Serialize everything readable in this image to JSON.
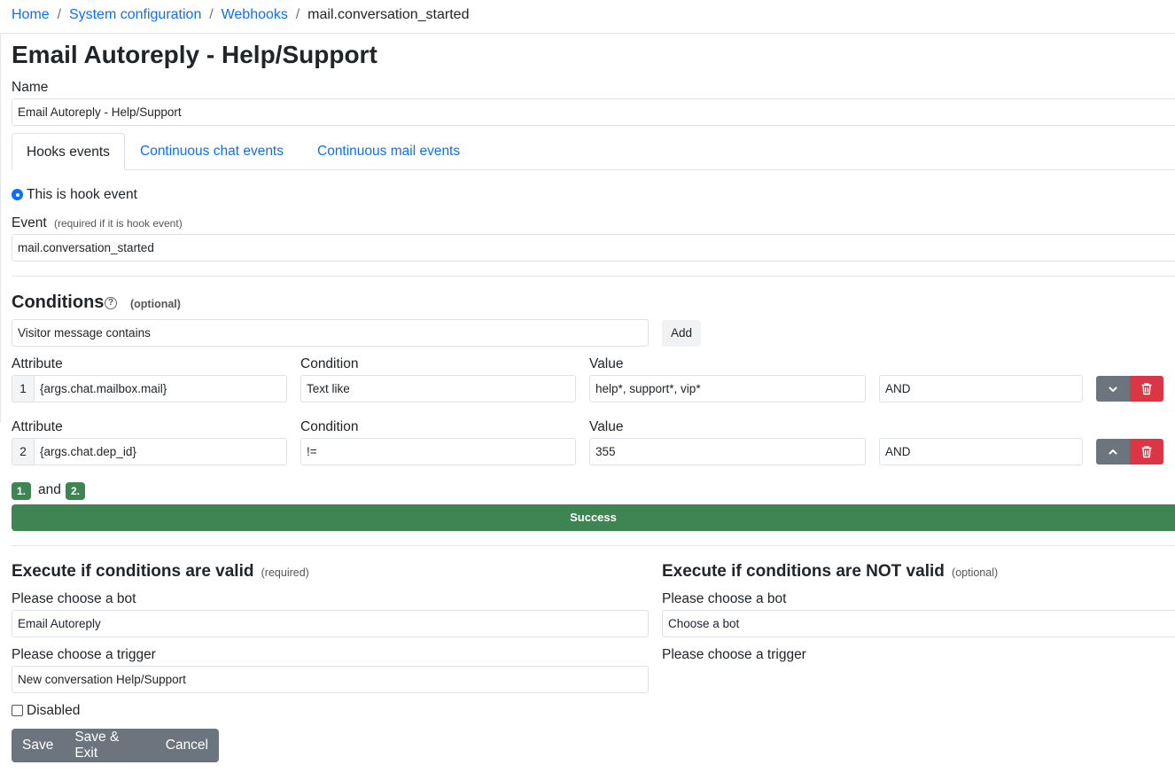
{
  "breadcrumb": {
    "items": [
      "Home",
      "System configuration",
      "Webhooks"
    ],
    "current": "mail.conversation_started"
  },
  "page_title": "Email Autoreply - Help/Support",
  "name_field": {
    "label": "Name",
    "value": "Email Autoreply - Help/Support"
  },
  "tabs": [
    "Hooks events",
    "Continuous chat events",
    "Continuous mail events"
  ],
  "hook_radio_label": "This is hook event",
  "event_field": {
    "label": "Event",
    "hint": "(required if it is hook event)",
    "value": "mail.conversation_started"
  },
  "conditions": {
    "title": "Conditions",
    "optional_label": "(optional)",
    "help_icon": "question-circle-icon",
    "select_value": "Visitor message contains",
    "add_label": "Add",
    "headers": {
      "attribute": "Attribute",
      "condition": "Condition",
      "value": "Value"
    },
    "rows": [
      {
        "index": "1",
        "attribute": "{args.chat.mailbox.mail}",
        "condition": "Text like",
        "value": "help*, support*, vip*",
        "logic": "AND",
        "move_icon": "chevron-down-icon"
      },
      {
        "index": "2",
        "attribute": "{args.chat.dep_id}",
        "condition": "!=",
        "value": "355",
        "logic": "AND",
        "move_icon": "chevron-up-icon"
      }
    ],
    "expression": {
      "first": "1.",
      "joiner": "and",
      "second": "2."
    },
    "result": "Success",
    "result_color": "#3f8453"
  },
  "execute_valid": {
    "title": "Execute if conditions are valid",
    "tag": "(required)",
    "bot_label": "Please choose a bot",
    "bot_value": "Email Autoreply",
    "trigger_label": "Please choose a trigger",
    "trigger_value": "New conversation Help/Support"
  },
  "execute_invalid": {
    "title": "Execute if conditions are NOT valid",
    "tag": "(optional)",
    "bot_label": "Please choose a bot",
    "bot_value": "Choose a bot",
    "trigger_label": "Please choose a trigger"
  },
  "disabled_label": "Disabled",
  "actions": {
    "save": "Save",
    "save_exit": "Save & Exit",
    "cancel": "Cancel"
  },
  "colors": {
    "link": "#0d6efd",
    "success": "#3f8453",
    "danger": "#dc3545",
    "secondary": "#6c757d"
  }
}
